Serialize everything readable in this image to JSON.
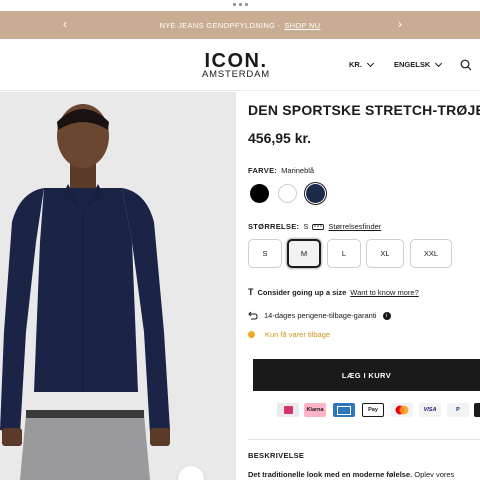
{
  "promo": {
    "text": "NYE JEANS GENOPFYLDNING -",
    "link": "SHOP NU"
  },
  "header": {
    "logo_line1": "ICON.",
    "logo_line2": "AMSTERDAM",
    "currency": "KR.",
    "language": "ENGELSK"
  },
  "product": {
    "title": "DEN SPORTSKE STRETCH-TRØJE",
    "price": "456,95 kr.",
    "color_label": "FARVE:",
    "color_value": "Marineblå",
    "colors": [
      "#000000",
      "#ffffff",
      "#1b2a4a"
    ],
    "size_label": "STØRRELSE:",
    "size_value": "S",
    "size_finder": "Størrelsesfinder",
    "sizes": [
      "S",
      "M",
      "L",
      "XL",
      "XXL"
    ],
    "selected_size": "M"
  },
  "fit_tip": {
    "bold": "Consider going up a size",
    "link": "Want to know more?"
  },
  "guarantee": "14-dages pengene-tilbage-garanti",
  "stock": "Kun få varer tilbage",
  "cart_button": "LÆG I KURV",
  "payments": [
    "Klarna",
    "Pay",
    "VISA",
    "P"
  ],
  "description": {
    "heading": "BESKRIVELSE",
    "bold": "Det traditionelle look med en moderne følelse.",
    "rest": " Oplev vores"
  },
  "colors": {
    "promo_bg": "#c9ad92",
    "stock_dot": "#f5a623",
    "cart_bg": "#1a1a1a"
  }
}
